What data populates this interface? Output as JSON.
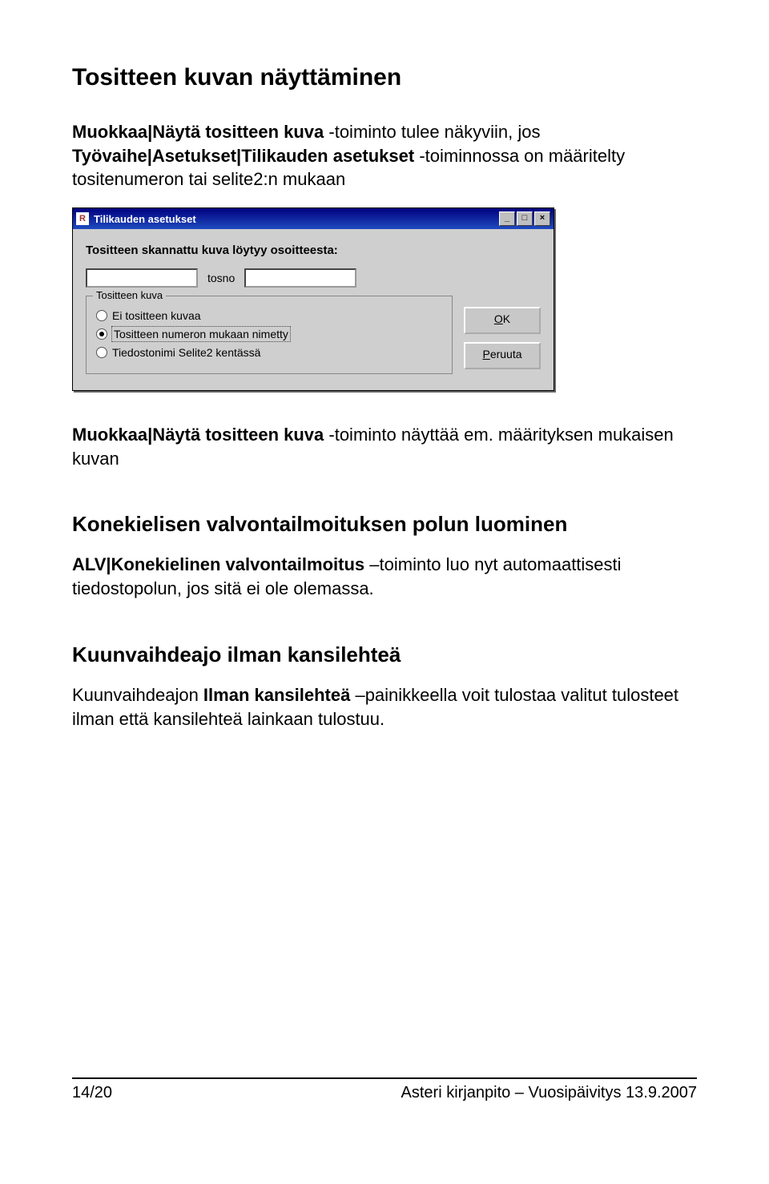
{
  "heading1": "Tositteen kuvan näyttäminen",
  "para1_prefix": "Muokkaa|Näytä tositteen kuva",
  "para1_mid": " -toiminto tulee näkyviin, jos ",
  "para1_bold2": "Työvaihe|Asetukset|Tilikauden asetukset",
  "para1_suffix": " -toiminnossa on määritelty tositenumeron tai selite2:n mukaan",
  "dialog": {
    "title": "Tilikauden asetukset",
    "appicon_text": "R",
    "min": "_",
    "max": "□",
    "close": "×",
    "prompt": "Tositteen skannattu kuva löytyy osoitteesta:",
    "input1_value": "",
    "tosno": "tosno",
    "input2_value": "",
    "group_legend": "Tositteen kuva",
    "radio1": "Ei tositteen kuvaa",
    "radio2": "Tositteen numeron mukaan nimetty",
    "radio3": "Tiedostonimi Selite2 kentässä",
    "ok": "OK",
    "cancel": "Peruuta"
  },
  "para2_bold": "Muokkaa|Näytä tositteen kuva",
  "para2_rest": " -toiminto näyttää em. määrityksen mukaisen kuvan",
  "heading2": "Konekielisen valvontailmoituksen polun luominen",
  "para3_bold": "ALV|Konekielinen valvontailmoitus",
  "para3_rest": " –toiminto luo nyt automaattisesti tiedostopolun, jos sitä ei ole olemassa.",
  "heading3": "Kuunvaihdeajo ilman kansilehteä",
  "para4_pre": "Kuunvaihdeajon ",
  "para4_bold": "Ilman kansilehteä",
  "para4_rest": " –painikkeella voit tulostaa valitut tulosteet ilman että kansilehteä lainkaan tulostuu.",
  "footer_left": "14/20",
  "footer_right": "Asteri kirjanpito – Vuosipäivitys 13.9.2007"
}
